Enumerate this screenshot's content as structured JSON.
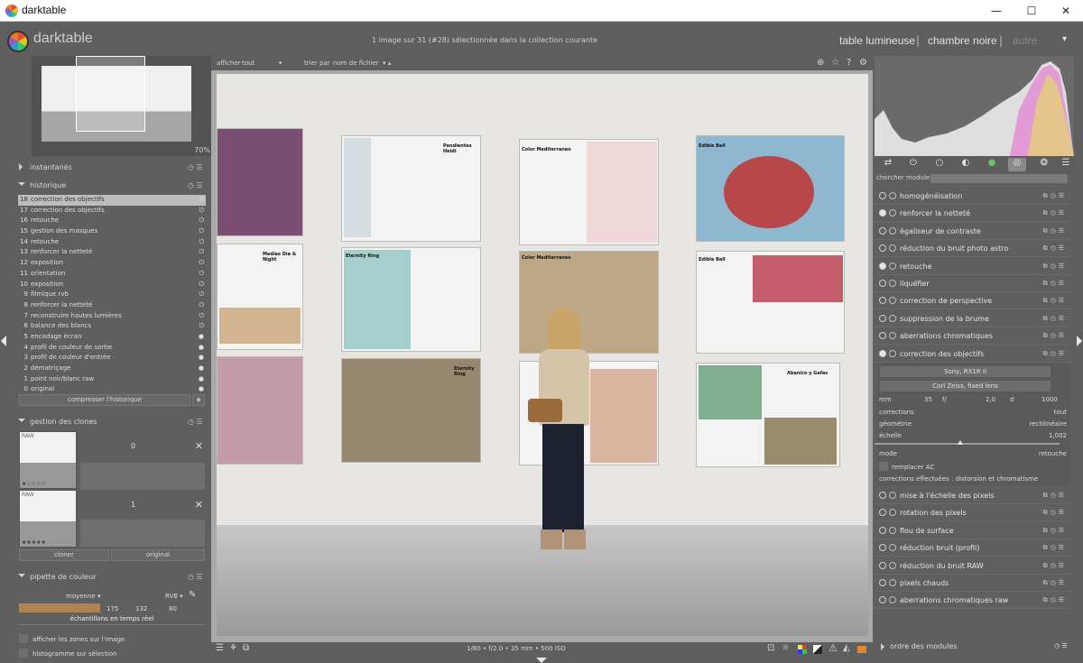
{
  "window": {
    "title": "darktable",
    "controls": {
      "minimize": "—",
      "maximize": "☐",
      "close": "✕"
    }
  },
  "header": {
    "app_name": "darktable",
    "status": "1 image sur 31 (#28) sélectionnée dans la collection courante",
    "views": [
      "table lumineuse",
      "chambre noire",
      "autre"
    ],
    "separator": "|",
    "more": "▾"
  },
  "left": {
    "navigation": {
      "zoom": "70%"
    },
    "snapshots": {
      "label": "instantanés",
      "icons": "◷ ☰"
    },
    "history": {
      "label": "historique",
      "icons": "◷ ☰",
      "items": [
        {
          "num": "18",
          "label": "correction des objectifs",
          "selected": true
        },
        {
          "num": "17",
          "label": "correction des objectifs"
        },
        {
          "num": "16",
          "label": "retouche"
        },
        {
          "num": "15",
          "label": "gestion des masques"
        },
        {
          "num": "14",
          "label": "retouche"
        },
        {
          "num": "13",
          "label": "renforcer la netteté"
        },
        {
          "num": "12",
          "label": "exposition"
        },
        {
          "num": "11",
          "label": "orientation"
        },
        {
          "num": "10",
          "label": "exposition"
        },
        {
          "num": "9",
          "label": "filmique rvb"
        },
        {
          "num": "8",
          "label": "renforcer la netteté"
        },
        {
          "num": "7",
          "label": "reconstruire hautes lumières"
        },
        {
          "num": "6",
          "label": "balance des blancs"
        },
        {
          "num": "5",
          "label": "encodage écran"
        },
        {
          "num": "4",
          "label": "profil de couleur de sortie"
        },
        {
          "num": "3",
          "label": "profil de couleur d'entrée"
        },
        {
          "num": "2",
          "label": "dématriçage"
        },
        {
          "num": "1",
          "label": "point noir/blanc raw"
        },
        {
          "num": "0",
          "label": "original"
        }
      ],
      "compress_button": "compresser l'historique"
    },
    "clones": {
      "label": "gestion des clones",
      "items": [
        {
          "label": "0",
          "stars": "★☆☆☆☆"
        },
        {
          "label": "1",
          "stars": "★★★★★"
        }
      ],
      "thumb_tag": "RAW",
      "reject": "✕",
      "clone_button": "cloner",
      "original_button": "original"
    },
    "picker": {
      "label": "pipette de couleur",
      "mode": "moyenne",
      "space": "RVB",
      "values": [
        "175",
        "132",
        "80"
      ],
      "swatch_color": "#af8450",
      "live_samples": "échantillons en temps réel",
      "show_zones": "afficher les zones sur l'image",
      "selection_histogram": "histogramme sur sélection"
    }
  },
  "filter": {
    "show_label": "afficher",
    "show_value": "tout",
    "sort_label": "trier par",
    "sort_value": "nom de fichier"
  },
  "photo": {
    "poster_titles": [
      "Pendientes Heidi",
      "Color Mediterraneo",
      "Edible Bell",
      "Medias Día & Night",
      "Eternity Ring",
      "Color Mediterraneo",
      "Edible Bell",
      "Eternity Ring",
      "Abanico y Gafas"
    ]
  },
  "bottom": {
    "exif": "1/80 • f/2.0 • 35 mm • 500 ISO"
  },
  "right": {
    "search_placeholder": "chercher module",
    "modules": [
      {
        "label": "homogénéisation",
        "on": false
      },
      {
        "label": "renforcer la netteté",
        "on": true
      },
      {
        "label": "égaliseur de contraste",
        "on": false
      },
      {
        "label": "réduction du bruit photo astro",
        "on": false
      },
      {
        "label": "retouche",
        "on": true
      },
      {
        "label": "liquéfier",
        "on": false
      },
      {
        "label": "correction de perspective",
        "on": false
      },
      {
        "label": "suppression de la brume",
        "on": false
      },
      {
        "label": "aberrations chromatiques",
        "on": false
      },
      {
        "label": "correction des objectifs",
        "on": true
      }
    ],
    "lens": {
      "camera": "Sony, RX1R II",
      "lens": "Carl Zeiss, fixed lens",
      "params": {
        "mm_label": "mm",
        "mm_value": "35",
        "f_label": "f/",
        "f_value": "2,0",
        "d_label": "d",
        "d_value": "1000"
      },
      "corrections_label": "corrections",
      "corrections_value": "tout",
      "geometry_label": "géométrie",
      "geometry_value": "rectilinéaire",
      "scale_label": "échelle",
      "scale_value": "1,002",
      "mode_label": "mode",
      "mode_value": "retouche",
      "replace_ac": "remplacer AC",
      "effective": "corrections effectuées : distorsion et chromatisme"
    },
    "modules_after": [
      {
        "label": "mise à l'échelle des pixels",
        "on": false
      },
      {
        "label": "rotation des pixels",
        "on": false
      },
      {
        "label": "flou de surface",
        "on": false
      },
      {
        "label": "réduction bruit (profil)",
        "on": false
      },
      {
        "label": "réduction du bruit RAW",
        "on": false
      },
      {
        "label": "pixels chauds",
        "on": false
      },
      {
        "label": "aberrations chromatiques raw",
        "on": false
      }
    ],
    "module_order": "ordre des modules"
  }
}
